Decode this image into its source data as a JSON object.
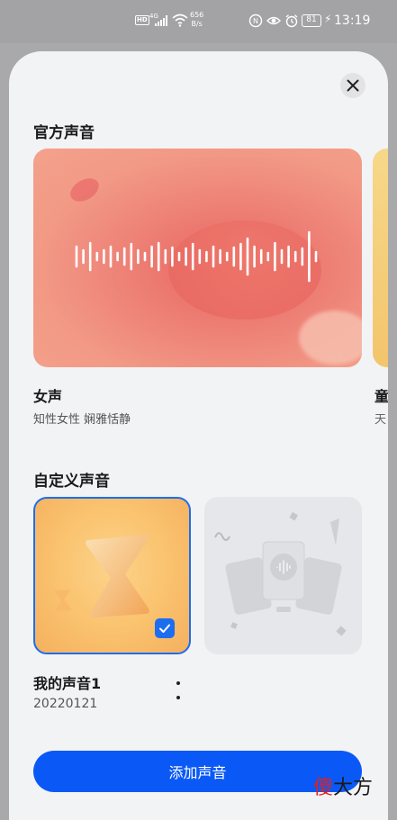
{
  "status_bar": {
    "hd_label": "HD",
    "network_label": "4G",
    "net_speed_value": "656",
    "net_speed_unit": "B/s",
    "battery_level": "81",
    "time": "13:19"
  },
  "sheet": {
    "official_title": "官方声音",
    "official_voice": {
      "name": "女声",
      "description": "知性女性 娴雅恬静"
    },
    "next_voice": {
      "name": "童",
      "description": "天"
    },
    "custom_title": "自定义声音",
    "custom_voice": {
      "name": "我的声音1",
      "date": "20220121",
      "selected": true
    },
    "add_button_label": "添加声音"
  },
  "watermark": {
    "first_char": "傻",
    "rest": "大方"
  },
  "colors": {
    "accent": "#0a59f7",
    "selection_border": "#1d6df0",
    "sheet_background": "#f2f3f5"
  }
}
